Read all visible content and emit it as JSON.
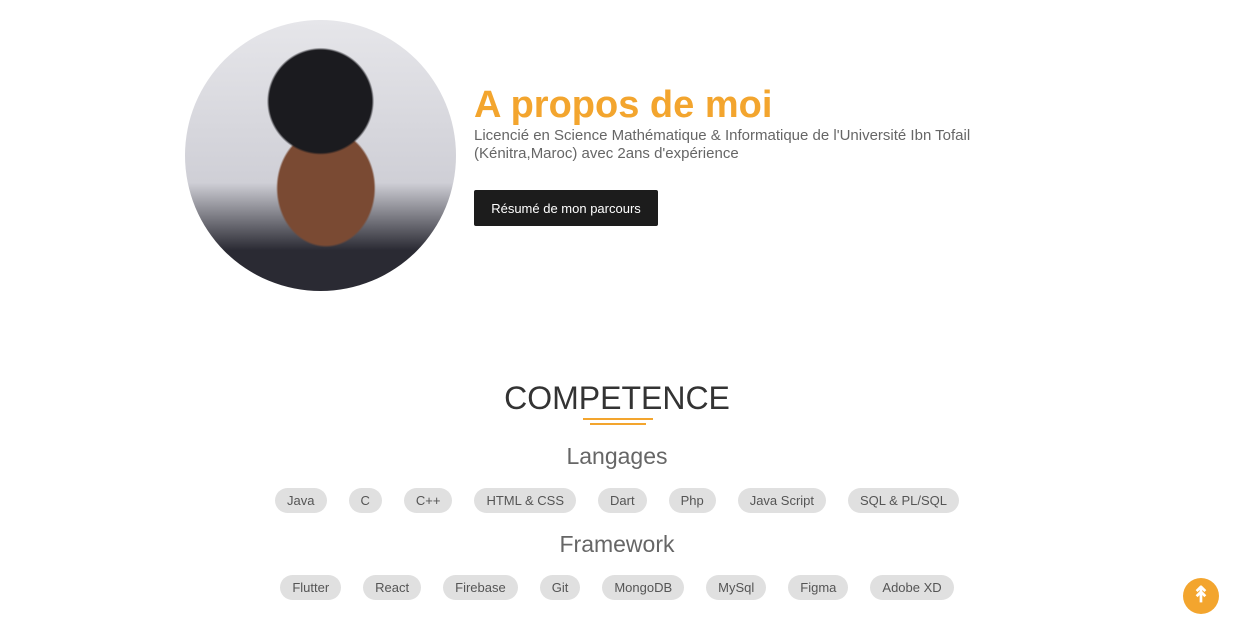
{
  "about": {
    "title": "A propos de moi",
    "description": "Licencié en Science Mathématique & Informatique de l'Université Ibn Tofail (Kénitra,Maroc) avec 2ans d'expérience",
    "button": "Résumé de mon parcours"
  },
  "skills": {
    "title": "COMPETENCE",
    "languages_title": "Langages",
    "languages": [
      "Java",
      "C",
      "C++",
      "HTML & CSS",
      "Dart",
      "Php",
      "Java Script",
      "SQL & PL/SQL"
    ],
    "frameworks_title": "Framework",
    "frameworks": [
      "Flutter",
      "React",
      "Firebase",
      "Git",
      "MongoDB",
      "MySql",
      "Figma",
      "Adobe XD"
    ]
  },
  "colors": {
    "accent": "#f3a52e"
  },
  "scroll_top_icon": "double-chevron-up-icon"
}
